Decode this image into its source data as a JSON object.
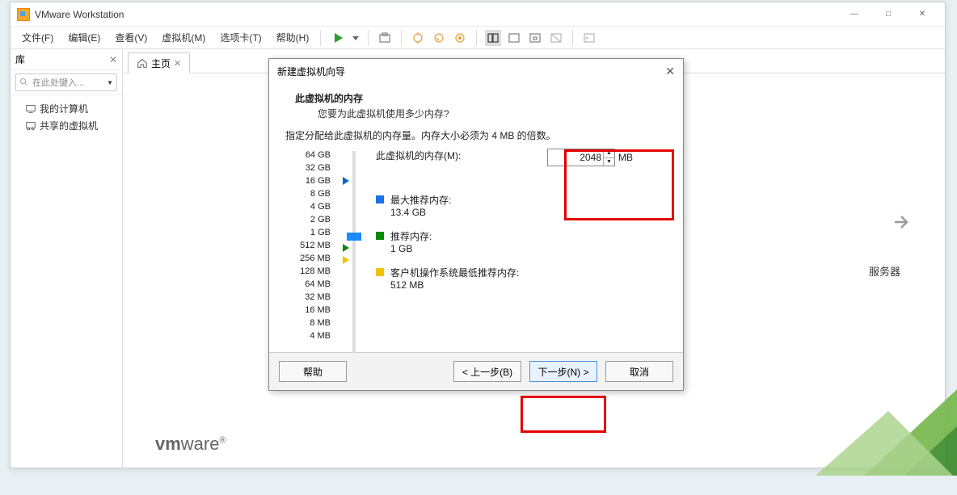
{
  "app": {
    "title": "VMware Workstation"
  },
  "window_controls": {
    "min": "—",
    "max": "□",
    "close": "✕"
  },
  "menus": {
    "file": "文件(F)",
    "edit": "编辑(E)",
    "view": "查看(V)",
    "vm": "虚拟机(M)",
    "tabs": "选项卡(T)",
    "help": "帮助(H)"
  },
  "sidebar": {
    "header": "库",
    "search_placeholder": "在此处键入...",
    "search_dropdown": "▼",
    "items": [
      "我的计算机",
      "共享的虚拟机"
    ]
  },
  "tabs_row": {
    "home": "主页"
  },
  "main": {
    "server_label": "服务器",
    "logo_html": "vmware"
  },
  "dialog": {
    "title": "新建虚拟机向导",
    "heading": "此虚拟机的内存",
    "question": "您要为此虚拟机使用多少内存?",
    "instruction": "指定分配给此虚拟机的内存量。内存大小必须为 4 MB 的倍数。",
    "memory_label": "此虚拟机的内存(M):",
    "memory_value": "2048",
    "unit": "MB",
    "scale": [
      "64 GB",
      "32 GB",
      "16 GB",
      "8 GB",
      "4 GB",
      "2 GB",
      "1 GB",
      "512 MB",
      "256 MB",
      "128 MB",
      "64 MB",
      "32 MB",
      "16 MB",
      "8 MB",
      "4 MB"
    ],
    "max_rec_label": "最大推荐内存:",
    "max_rec_val": "13.4 GB",
    "rec_label": "推荐内存:",
    "rec_val": "1 GB",
    "guest_min_label": "客户机操作系统最低推荐内存:",
    "guest_min_val": "512 MB",
    "btn_help": "帮助",
    "btn_back": "< 上一步(B)",
    "btn_next": "下一步(N) >",
    "btn_cancel": "取消"
  }
}
